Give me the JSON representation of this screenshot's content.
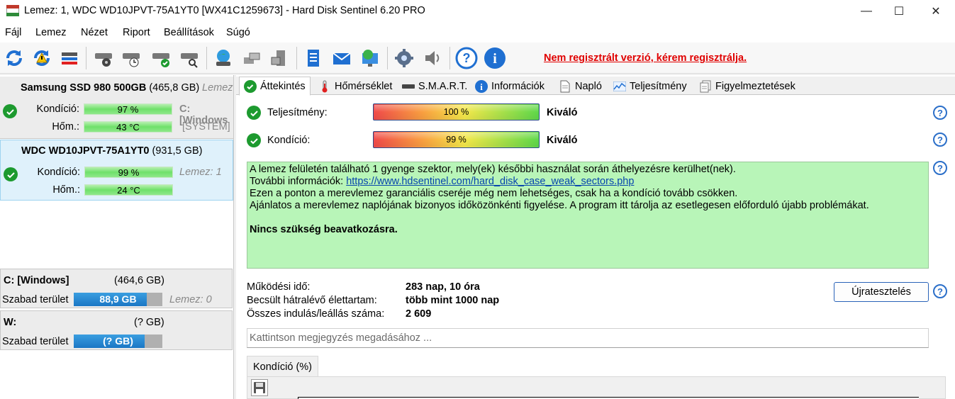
{
  "window": {
    "title": "Lemez: 1, WDC WD10JPVT-75A1YT0 [WX41C1259673]  -  Hard Disk Sentinel 6.20 PRO",
    "minimize": "—",
    "maximize": "☐",
    "close": "✕"
  },
  "menu": [
    "Fájl",
    "Lemez",
    "Nézet",
    "Riport",
    "Beállítások",
    "Súgó"
  ],
  "toolbar": {
    "register_text": "Nem regisztrált verzió, kérem regisztrálja.",
    "icons": [
      "refresh-icon",
      "refresh-warning-icon",
      "disk-list-icon",
      "disk-test-icon",
      "disk-schedule-icon",
      "disk-check-icon",
      "disk-search-icon",
      "globe-disk-icon",
      "network-icon",
      "server-icon",
      "notepad-icon",
      "mail-icon",
      "monitor-globe-icon",
      "settings-gear-icon",
      "speaker-icon",
      "help-icon",
      "info-icon"
    ]
  },
  "disks": [
    {
      "name": "Samsung SSD 980 500GB",
      "size": "(465,8 GB)",
      "extra": "Lemez",
      "condition_label": "Kondíció:",
      "condition_value": "97 %",
      "temp_label": "Hőm.:",
      "temp_value": "43 °C",
      "partition": "C: [Windows",
      "partition2": "[SYSTEM]"
    },
    {
      "name": "WDC WD10JPVT-75A1YT0",
      "size": "(931,5 GB)",
      "extra": "Lemez: 1",
      "condition_label": "Kondíció:",
      "condition_value": "99 %",
      "temp_label": "Hőm.:",
      "temp_value": "24 °C"
    }
  ],
  "volumes": [
    {
      "name": "C: [Windows]",
      "size": "(464,6 GB)",
      "free_label": "Szabad terület",
      "free_value": "88,9 GB",
      "fill_fraction": 0.82,
      "extra": "Lemez: 0"
    },
    {
      "name": "W:",
      "size": "(? GB)",
      "free_label": "Szabad terület",
      "free_value": "(? GB)",
      "fill_fraction": 0.8
    }
  ],
  "tabs": [
    "Áttekintés",
    "Hőmérséklet",
    "S.M.A.R.T.",
    "Információk",
    "Napló",
    "Teljesítmény",
    "Figyelmeztetések"
  ],
  "overview": {
    "performance_label": "Teljesítmény:",
    "performance_value": "100 %",
    "performance_rating": "Kiváló",
    "condition_label": "Kondíció:",
    "condition_value": "99 %",
    "condition_rating": "Kiváló",
    "info_line1": "A lemez felületén található 1 gyenge szektor, mely(ek) későbbi használat során áthelyezésre kerülhet(nek).",
    "info_line2_prefix": "További információk: ",
    "info_link": "https://www.hdsentinel.com/hard_disk_case_weak_sectors.php",
    "info_line3": "Ezen a ponton a merevlemez garanciális cseréje még nem lehetséges, csak ha a kondíció tovább csökken.",
    "info_line4": "Ajánlatos a merevlemez naplójának bizonyos időközönkénti figyelése. A program itt tárolja az esetlegesen előforduló újabb problémákat.",
    "info_strong": "Nincs szükség beavatkozásra.",
    "uptime_label": "Működési idő:",
    "uptime_value": "283 nap, 10 óra",
    "remaining_label": "Becsült hátralévő élettartam:",
    "remaining_value": "több mint 1000 nap",
    "starts_label": "Összes indulás/leállás száma:",
    "starts_value": "2 609",
    "retest_button": "Újratesztelés",
    "note_placeholder": "Kattintson megjegyzés megadásához ...",
    "chart_tab": "Kondíció  (%)",
    "help_symbol": "?"
  },
  "colors": {
    "accent_blue": "#2b6fc9",
    "ok_green": "#1d9a2f",
    "info_bg": "#b8f5b8",
    "warning_red": "#e00000"
  }
}
